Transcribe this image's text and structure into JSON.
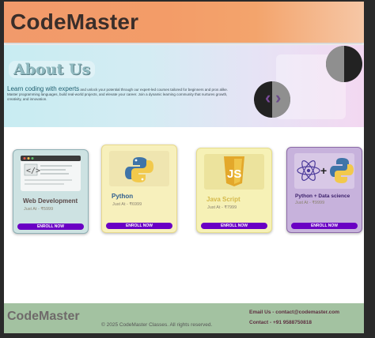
{
  "header": {
    "brand": "CodeMaster"
  },
  "hero": {
    "title": "About Us",
    "lead": "Learn coding with experts",
    "lead_rest": " and unlock your potential through our expert-led courses tailored for beginners and pros alike.",
    "body": "Master programming languages, build real-world projects, and elevate your career. Join a dynamic learning community that nurtures growth, creativity, and innovation."
  },
  "carousel": {
    "prev_glyph": "‹",
    "next_glyph": "›"
  },
  "courses": [
    {
      "title": "Web Development",
      "price": "Just At - ₹5999",
      "enroll": "ENROLL NOW"
    },
    {
      "title": "Python",
      "price": "Just At - ₹6999",
      "enroll": "ENROLL NOW"
    },
    {
      "title": "Java Script",
      "price": "Just At - ₹7999",
      "enroll": "ENROLL NOW"
    },
    {
      "title": "Python + Data science",
      "price": "Just At - ₹9999",
      "enroll": "ENROLL NOW"
    }
  ],
  "footer": {
    "logo": "CodeMaster",
    "copyright": "© 2025 CodeMaster Classes. All rights reserved.",
    "email": "Email Us - contact@codemaster.com",
    "contact": "Contact - +91 9588750818"
  },
  "colors": {
    "accent": "#6a00c4",
    "header": "#f39c68",
    "footer": "#a3c2a1"
  }
}
